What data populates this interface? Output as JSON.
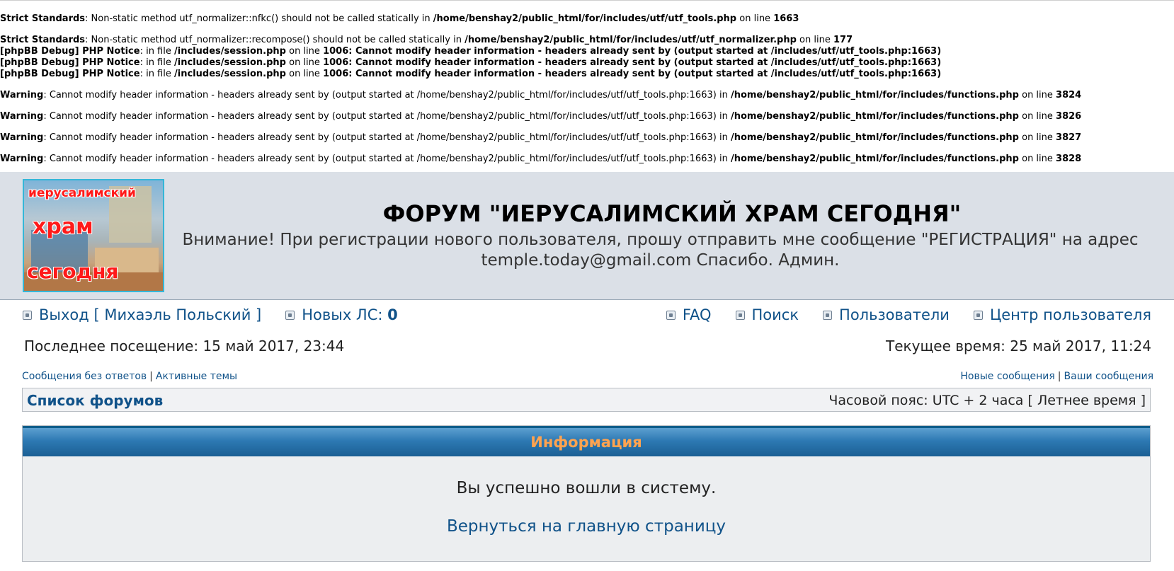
{
  "errors": [
    {
      "type": "Strict Standards",
      "text": "Non-static method utf_normalizer::nfkc() should not be called statically in",
      "file": "/home/benshay2/public_html/for/includes/utf/utf_tools.php",
      "line_label": "on line",
      "line": "1663",
      "gap": false
    },
    {
      "type": "Strict Standards",
      "text": "Non-static method utf_normalizer::recompose() should not be called statically in",
      "file": "/home/benshay2/public_html/for/includes/utf/utf_normalizer.php",
      "line_label": "on line",
      "line": "177",
      "gap": true
    },
    {
      "type": "[phpBB Debug] PHP Notice",
      "text": "in file",
      "file": "/includes/session.php",
      "line_label": "on line",
      "line": "1006: Cannot modify header information - headers already sent by (output started at /includes/utf/utf_tools.php:1663)",
      "gap": false
    },
    {
      "type": "[phpBB Debug] PHP Notice",
      "text": "in file",
      "file": "/includes/session.php",
      "line_label": "on line",
      "line": "1006: Cannot modify header information - headers already sent by (output started at /includes/utf/utf_tools.php:1663)",
      "gap": false
    },
    {
      "type": "[phpBB Debug] PHP Notice",
      "text": "in file",
      "file": "/includes/session.php",
      "line_label": "on line",
      "line": "1006: Cannot modify header information - headers already sent by (output started at /includes/utf/utf_tools.php:1663)",
      "gap": false
    },
    {
      "type": "Warning",
      "text": "Cannot modify header information - headers already sent by (output started at /home/benshay2/public_html/for/includes/utf/utf_tools.php:1663) in",
      "file": "/home/benshay2/public_html/for/includes/functions.php",
      "line_label": "on line",
      "line": "3824",
      "gap": true
    },
    {
      "type": "Warning",
      "text": "Cannot modify header information - headers already sent by (output started at /home/benshay2/public_html/for/includes/utf/utf_tools.php:1663) in",
      "file": "/home/benshay2/public_html/for/includes/functions.php",
      "line_label": "on line",
      "line": "3826",
      "gap": true
    },
    {
      "type": "Warning",
      "text": "Cannot modify header information - headers already sent by (output started at /home/benshay2/public_html/for/includes/utf/utf_tools.php:1663) in",
      "file": "/home/benshay2/public_html/for/includes/functions.php",
      "line_label": "on line",
      "line": "3827",
      "gap": true
    },
    {
      "type": "Warning",
      "text": "Cannot modify header information - headers already sent by (output started at /home/benshay2/public_html/for/includes/utf/utf_tools.php:1663) in",
      "file": "/home/benshay2/public_html/for/includes/functions.php",
      "line_label": "on line",
      "line": "3828",
      "gap": true
    }
  ],
  "header": {
    "logo_line1": "иерусалимский",
    "logo_line2": "храм",
    "logo_line3": "сегодня",
    "title": "ФОРУМ \"ИЕРУСАЛИМСКИЙ ХРАМ СЕГОДНЯ\"",
    "description": "Внимание! При регистрации нового пользователя, прошу отправить мне сообщение \"РЕГИСТРАЦИЯ\" на адрес temple.today@gmail.com Спасибо. Админ."
  },
  "nav": {
    "logout": "Выход [ Михаэль Польский ]",
    "new_pm_label": "Новых ЛС:",
    "new_pm_count": "0",
    "faq": "FAQ",
    "search": "Поиск",
    "members": "Пользователи",
    "ucp": "Центр пользователя"
  },
  "visits": {
    "last_visit": "Последнее посещение: 15 май 2017, 23:44",
    "current_time": "Текущее время: 25 май 2017, 11:24"
  },
  "links": {
    "unanswered": "Сообщения без ответов",
    "separator": "|",
    "active": "Активные темы",
    "new_posts": "Новые сообщения",
    "your_posts": "Ваши сообщения"
  },
  "breadcrumb": {
    "index": "Список форумов",
    "timezone": "Часовой пояс: UTC + 2 часа [ Летнее время ]"
  },
  "info": {
    "title": "Информация",
    "message": "Вы успешно вошли в систему.",
    "back_link": "Вернуться на главную страницу"
  },
  "colors": {
    "link": "#105289",
    "header_bg": "#dbe0e7",
    "info_title": "#ffa34f",
    "info_bar": "#2d79b3"
  }
}
